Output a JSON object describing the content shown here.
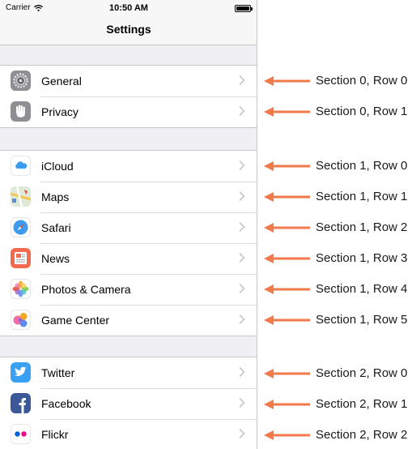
{
  "status_bar": {
    "carrier": "Carrier",
    "time": "10:50 AM"
  },
  "nav": {
    "title": "Settings"
  },
  "sections": [
    {
      "rows": [
        {
          "label": "General",
          "icon": "gear-icon",
          "annotation": "Section 0, Row 0"
        },
        {
          "label": "Privacy",
          "icon": "hand-icon",
          "annotation": "Section 0, Row 1"
        }
      ]
    },
    {
      "rows": [
        {
          "label": "iCloud",
          "icon": "cloud-icon",
          "annotation": "Section 1, Row 0"
        },
        {
          "label": "Maps",
          "icon": "map-icon",
          "annotation": "Section 1, Row 1"
        },
        {
          "label": "Safari",
          "icon": "compass-icon",
          "annotation": "Section 1, Row 2"
        },
        {
          "label": "News",
          "icon": "news-icon",
          "annotation": "Section 1, Row 3"
        },
        {
          "label": "Photos & Camera",
          "icon": "flower-icon",
          "annotation": "Section 1, Row 4"
        },
        {
          "label": "Game Center",
          "icon": "bubbles-icon",
          "annotation": "Section 1, Row 5"
        }
      ]
    },
    {
      "rows": [
        {
          "label": "Twitter",
          "icon": "bird-icon",
          "annotation": "Section 2, Row 0"
        },
        {
          "label": "Facebook",
          "icon": "f-letter-icon",
          "annotation": "Section 2, Row 1"
        },
        {
          "label": "Flickr",
          "icon": "two-dots-icon",
          "annotation": "Section 2, Row 2"
        }
      ]
    }
  ],
  "colors": {
    "arrow": "#f07a4a",
    "separator": "#c8c7cc",
    "background": "#efeff4",
    "chevron": "#c7c7cc"
  }
}
